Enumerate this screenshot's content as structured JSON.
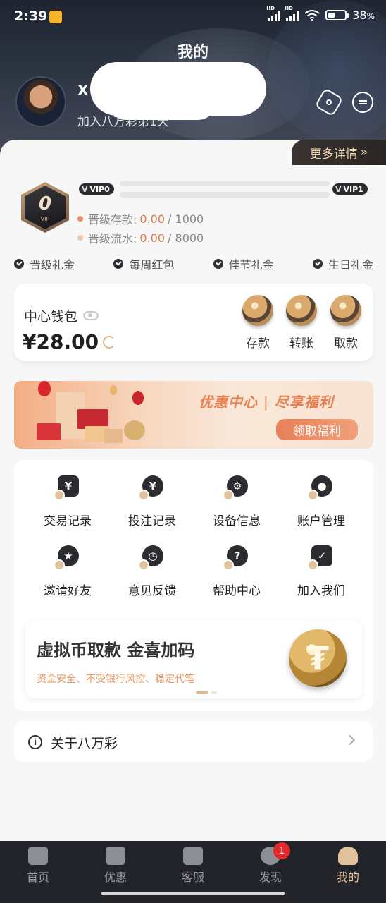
{
  "status_bar": {
    "time": "2:39",
    "battery": "38",
    "battery_unit": "%",
    "hd1": "HD",
    "hd2": "HD"
  },
  "header": {
    "title": "我的",
    "username": "X",
    "joined_text": "加入八万彩第1天"
  },
  "more_details": "更多详情",
  "vip": {
    "badge_level": "0",
    "badge_label": "VIP",
    "current": "VIP0",
    "next": "VIP1",
    "deposit_label": "晋级存款:",
    "deposit_value": "0.00",
    "deposit_total": "/ 1000",
    "turnover_label": "晋级流水:",
    "turnover_value": "0.00",
    "turnover_total": "/ 8000",
    "deposit_progress": 0,
    "turnover_progress": 0,
    "perks": [
      "晋级礼金",
      "每周红包",
      "佳节礼金",
      "生日礼金"
    ]
  },
  "wallet": {
    "title": "中心钱包",
    "amount": "¥28.00",
    "actions": [
      "存款",
      "转账",
      "取款"
    ]
  },
  "promo": {
    "slogan_left": "优惠中心",
    "divider": "|",
    "slogan_right": "尽享福利",
    "button": "领取福利"
  },
  "grid_items": [
    "交易记录",
    "投注记录",
    "设备信息",
    "账户管理",
    "邀请好友",
    "意见反馈",
    "帮助中心",
    "加入我们"
  ],
  "usdt_banner": {
    "headline": "虚拟币取款  金喜加码",
    "subline": "资金安全、不受银行风控、稳定代笔"
  },
  "about": {
    "label": "关于八万彩"
  },
  "tabs": [
    "首页",
    "优惠",
    "客服",
    "发现",
    "我的"
  ],
  "discover_badge": "1",
  "colors": {
    "accent": "#d87b4e",
    "gold": "#e2c29c",
    "dark": "#23232a"
  }
}
